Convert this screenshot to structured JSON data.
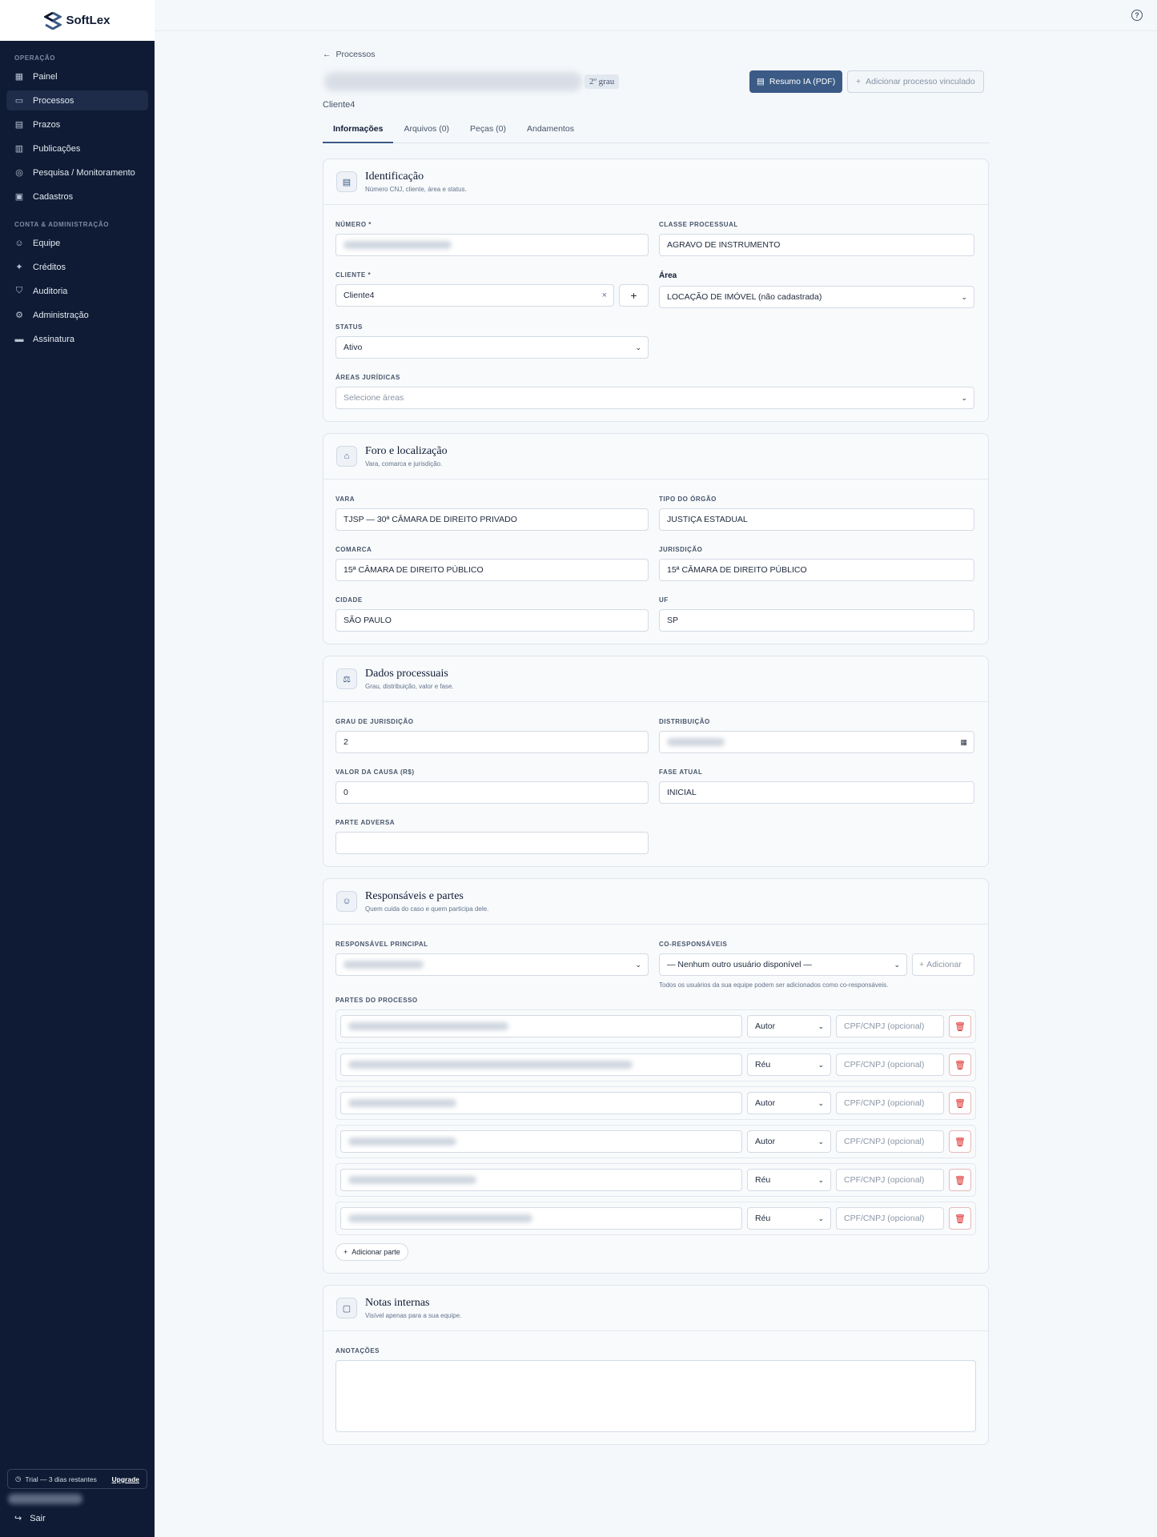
{
  "app": {
    "name": "SoftLex"
  },
  "sidebar": {
    "section_operacao": "OPERAÇÃO",
    "section_conta": "CONTA & ADMINISTRAÇÃO",
    "items_operacao": [
      {
        "label": "Painel",
        "icon": "dashboard-icon"
      },
      {
        "label": "Processos",
        "icon": "folder-icon",
        "active": true
      },
      {
        "label": "Prazos",
        "icon": "calendar-icon"
      },
      {
        "label": "Publicações",
        "icon": "newspaper-icon"
      },
      {
        "label": "Pesquisa / Monitoramento",
        "icon": "radar-icon"
      },
      {
        "label": "Cadastros",
        "icon": "notebook-icon"
      }
    ],
    "items_conta": [
      {
        "label": "Equipe",
        "icon": "users-icon"
      },
      {
        "label": "Créditos",
        "icon": "sparkles-icon"
      },
      {
        "label": "Auditoria",
        "icon": "shield-icon"
      },
      {
        "label": "Administração",
        "icon": "gear-icon"
      },
      {
        "label": "Assinatura",
        "icon": "credit-card-icon"
      }
    ],
    "trial_text": "Trial — 3 dias restantes",
    "upgrade": "Upgrade",
    "logout": "Sair"
  },
  "header": {
    "back_label": "Processos",
    "grau_badge": "2º grau",
    "btn_resumo": "Resumo IA (PDF)",
    "btn_vinculado": "Adicionar processo vinculado",
    "client": "Cliente4"
  },
  "tabs": [
    {
      "label": "Informações",
      "active": true
    },
    {
      "label": "Arquivos (0)"
    },
    {
      "label": "Peças (0)"
    },
    {
      "label": "Andamentos"
    }
  ],
  "identificacao": {
    "title": "Identificação",
    "subtitle": "Número CNJ, cliente, área e status.",
    "numero_label": "NÚMERO *",
    "classe_label": "CLASSE PROCESSUAL",
    "classe_value": "AGRAVO DE INSTRUMENTO",
    "cliente_label": "CLIENTE *",
    "cliente_value": "Cliente4",
    "area_label": "Área",
    "area_value": "LOCAÇÃO DE IMÓVEL (não cadastrada)",
    "status_label": "STATUS",
    "status_value": "Ativo",
    "areas_label": "ÁREAS JURÍDICAS",
    "areas_placeholder": "Selecione áreas"
  },
  "foro": {
    "title": "Foro e localização",
    "subtitle": "Vara, comarca e jurisdição.",
    "vara_label": "VARA",
    "vara_value": "TJSP — 30ª CÂMARA DE DIREITO PRIVADO",
    "tipo_label": "TIPO DO ÓRGÃO",
    "tipo_value": "JUSTIÇA ESTADUAL",
    "comarca_label": "COMARCA",
    "comarca_value": "15ª CÂMARA DE DIREITO PÚBLICO",
    "jurisdicao_label": "JURISDIÇÃO",
    "jurisdicao_value": "15ª CÂMARA DE DIREITO PÚBLICO",
    "cidade_label": "CIDADE",
    "cidade_value": "SÃO PAULO",
    "uf_label": "UF",
    "uf_value": "SP"
  },
  "dados": {
    "title": "Dados processuais",
    "subtitle": "Grau, distribuição, valor e fase.",
    "grau_label": "GRAU DE JURISDIÇÃO",
    "grau_value": "2",
    "distribuicao_label": "DISTRIBUIÇÃO",
    "valor_label": "VALOR DA CAUSA (R$)",
    "valor_value": "0",
    "fase_label": "FASE ATUAL",
    "fase_value": "INICIAL",
    "parte_label": "PARTE ADVERSA"
  },
  "responsaveis": {
    "title": "Responsáveis e partes",
    "subtitle": "Quem cuida do caso e quem participa dele.",
    "principal_label": "RESPONSÁVEL PRINCIPAL",
    "co_label": "CO-RESPONSÁVEIS",
    "co_value": "— Nenhum outro usuário disponível —",
    "add_label": "Adicionar",
    "hint": "Todos os usuários da sua equipe podem ser adicionados como co-responsáveis.",
    "partes_label": "PARTES DO PROCESSO",
    "cpf_placeholder": "CPF/CNPJ (opcional)",
    "partes": [
      {
        "role": "Autor"
      },
      {
        "role": "Réu"
      },
      {
        "role": "Autor"
      },
      {
        "role": "Autor"
      },
      {
        "role": "Réu"
      },
      {
        "role": "Réu"
      }
    ],
    "add_parte": "Adicionar parte"
  },
  "notas": {
    "title": "Notas internas",
    "subtitle": "Visível apenas para a sua equipe.",
    "anotacoes_label": "ANOTAÇÕES"
  }
}
